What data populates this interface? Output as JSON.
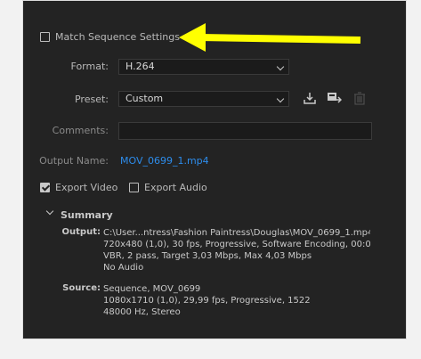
{
  "match_sequence_label": "Match Sequence Settings",
  "format": {
    "label": "Format:",
    "value": "H.264"
  },
  "preset": {
    "label": "Preset:",
    "value": "Custom"
  },
  "comments": {
    "label": "Comments:",
    "value": ""
  },
  "output_name": {
    "label": "Output Name:",
    "value": "MOV_0699_1.mp4"
  },
  "export_video_label": "Export Video",
  "export_audio_label": "Export Audio",
  "summary": {
    "title": "Summary",
    "output_label": "Output:",
    "output_lines": [
      "C:\\User...ntress\\Fashion Paintress\\Douglas\\MOV_0699_1.mp4",
      "720x480 (1,0), 30 fps, Progressive, Software Encoding, 00:00:...",
      "VBR, 2 pass, Target 3,03 Mbps, Max 4,03 Mbps",
      "No Audio"
    ],
    "source_label": "Source:",
    "source_lines": [
      "Sequence, MOV_0699",
      "1080x1710 (1,0), 29,99 fps, Progressive, 1522",
      "48000 Hz, Stereo"
    ]
  },
  "checkbox_states": {
    "match_sequence": false,
    "export_video": true,
    "export_audio": false
  },
  "icons": [
    "save-preset-icon",
    "import-preset-icon",
    "delete-preset-icon",
    "arrow-annotation-icon"
  ],
  "colors": {
    "annotation_arrow": "#ffff00",
    "link": "#2d8ceb",
    "panel_bg": "#232323"
  }
}
